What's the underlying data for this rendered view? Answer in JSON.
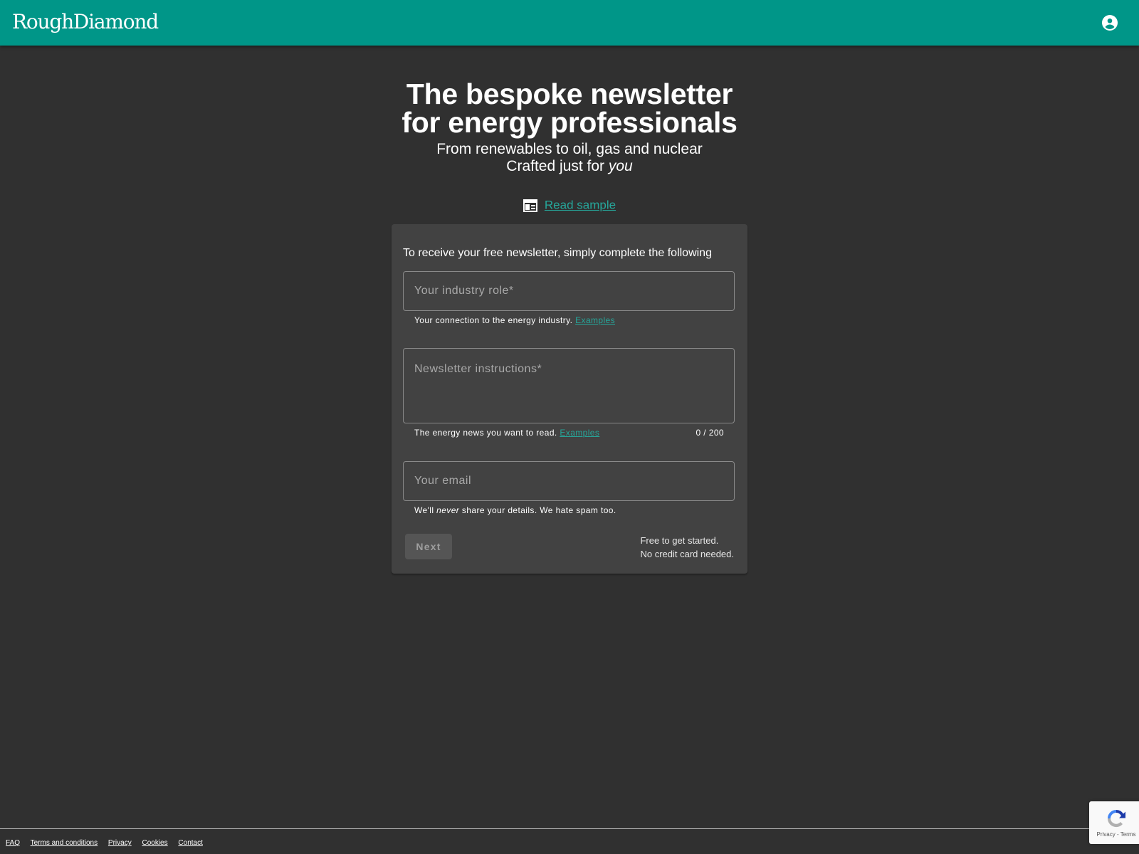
{
  "header": {
    "logo": "RoughDiamond",
    "account_icon": "account-circle-icon"
  },
  "hero": {
    "title_line1": "The bespoke newsletter",
    "title_line2": "for energy professionals",
    "subtitle_line1": "From renewables to oil, gas and nuclear",
    "subtitle_line2_prefix": "Crafted just for ",
    "subtitle_line2_em": "you",
    "sample_icon": "newspaper-icon",
    "sample_link": "Read sample"
  },
  "form": {
    "intro": "To receive your free newsletter, simply complete the following",
    "role": {
      "placeholder": "Your industry role*",
      "value": "",
      "hint": "Your connection to the energy industry. ",
      "hint_link": "Examples"
    },
    "instructions": {
      "placeholder": "Newsletter instructions*",
      "value": "",
      "hint": "The energy news you want to read. ",
      "hint_link": "Examples",
      "counter": "0 / 200"
    },
    "email": {
      "placeholder": "Your email",
      "value": "",
      "hint_prefix": "We'll ",
      "hint_em": "never",
      "hint_suffix": " share your details. We hate spam too."
    },
    "next_label": "Next",
    "free_line1": "Free to get started.",
    "free_line2": "No credit card needed."
  },
  "footer": {
    "links": [
      "FAQ",
      "Terms and conditions",
      "Privacy",
      "Cookies",
      "Contact"
    ]
  },
  "recaptcha": {
    "label": "Privacy - Terms"
  },
  "colors": {
    "brand": "#009688",
    "link": "#26a69a",
    "background": "#303030",
    "card": "#424242"
  }
}
